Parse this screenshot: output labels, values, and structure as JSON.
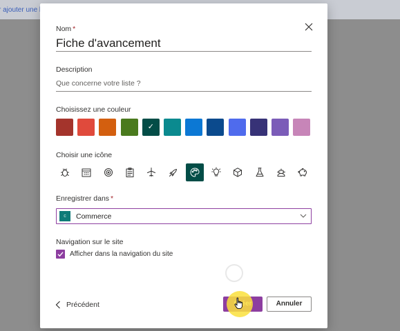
{
  "background": {
    "link_text": "r ajouter une lis"
  },
  "dialog": {
    "name_label": "Nom",
    "required_marker": "*",
    "name_value": "Fiche d'avancement",
    "description_label": "Description",
    "description_placeholder": "Que concerne votre liste ?",
    "color_label": "Choisissez une couleur",
    "colors": [
      "#a4342c",
      "#e04a3c",
      "#d35f0f",
      "#4a7a1d",
      "#034d47",
      "#0b8a8f",
      "#0c78d4",
      "#0b4a8d",
      "#4f6bed",
      "#373277",
      "#7b5cb8",
      "#c785b8"
    ],
    "selected_color_index": 4,
    "icon_label": "Choisir une icône",
    "icons": [
      "bug-icon",
      "calendar-icon",
      "target-icon",
      "clipboard-icon",
      "airplane-icon",
      "rocket-icon",
      "palette-icon",
      "lightbulb-icon",
      "cube-icon",
      "flask-icon",
      "robot-icon",
      "piggy-bank-icon"
    ],
    "selected_icon_index": 6,
    "save_in_label": "Enregistrer dans",
    "site_initial": "c",
    "site_name": "Commerce",
    "navigation_label": "Navigation sur le site",
    "show_in_nav_label": "Afficher dans la navigation du site",
    "show_in_nav_checked": true,
    "previous_label": "Précédent",
    "create_label": "Créer",
    "cancel_label": "Annuler"
  },
  "accent_color": "#8d3ea0"
}
